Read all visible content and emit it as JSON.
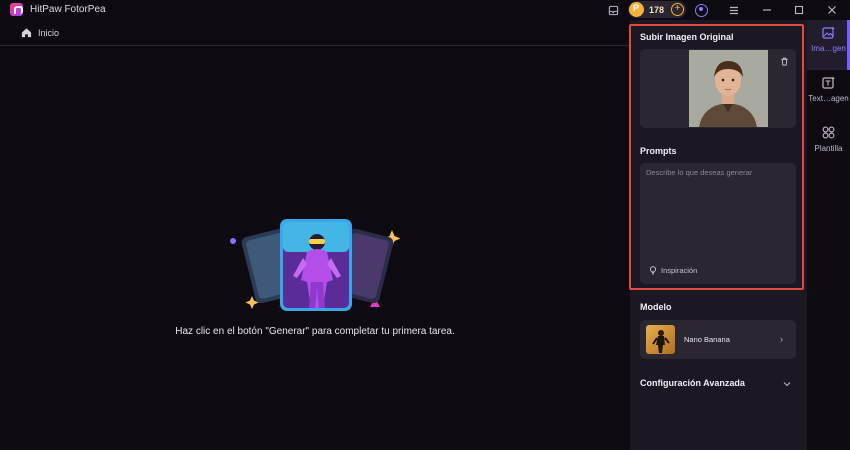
{
  "app": {
    "title": "HitPaw FotorPea"
  },
  "topbar": {
    "credits": "178"
  },
  "breadcrumb": {
    "label": "Inicio"
  },
  "main": {
    "empty_message": "Haz clic en el botón \"Generar\" para completar tu primera tarea."
  },
  "panel": {
    "upload_title": "Subir Imagen Original",
    "prompts_title": "Prompts",
    "prompt_placeholder": "Describe lo que deseas generar",
    "inspiration_label": "Inspiración",
    "model_title": "Modelo",
    "model_name": "Nano Banana",
    "advanced_title": "Configuración Avanzada"
  },
  "tools": [
    {
      "label": "Ima…gen",
      "icon": "image-ai-icon",
      "active": true
    },
    {
      "label": "Text…agen",
      "icon": "text-to-image-icon",
      "active": false
    },
    {
      "label": "Plantilla",
      "icon": "template-icon",
      "active": false
    }
  ],
  "colors": {
    "accent": "#7a5cff",
    "highlight": "#e04a3f",
    "coin": "#f4b23c"
  }
}
